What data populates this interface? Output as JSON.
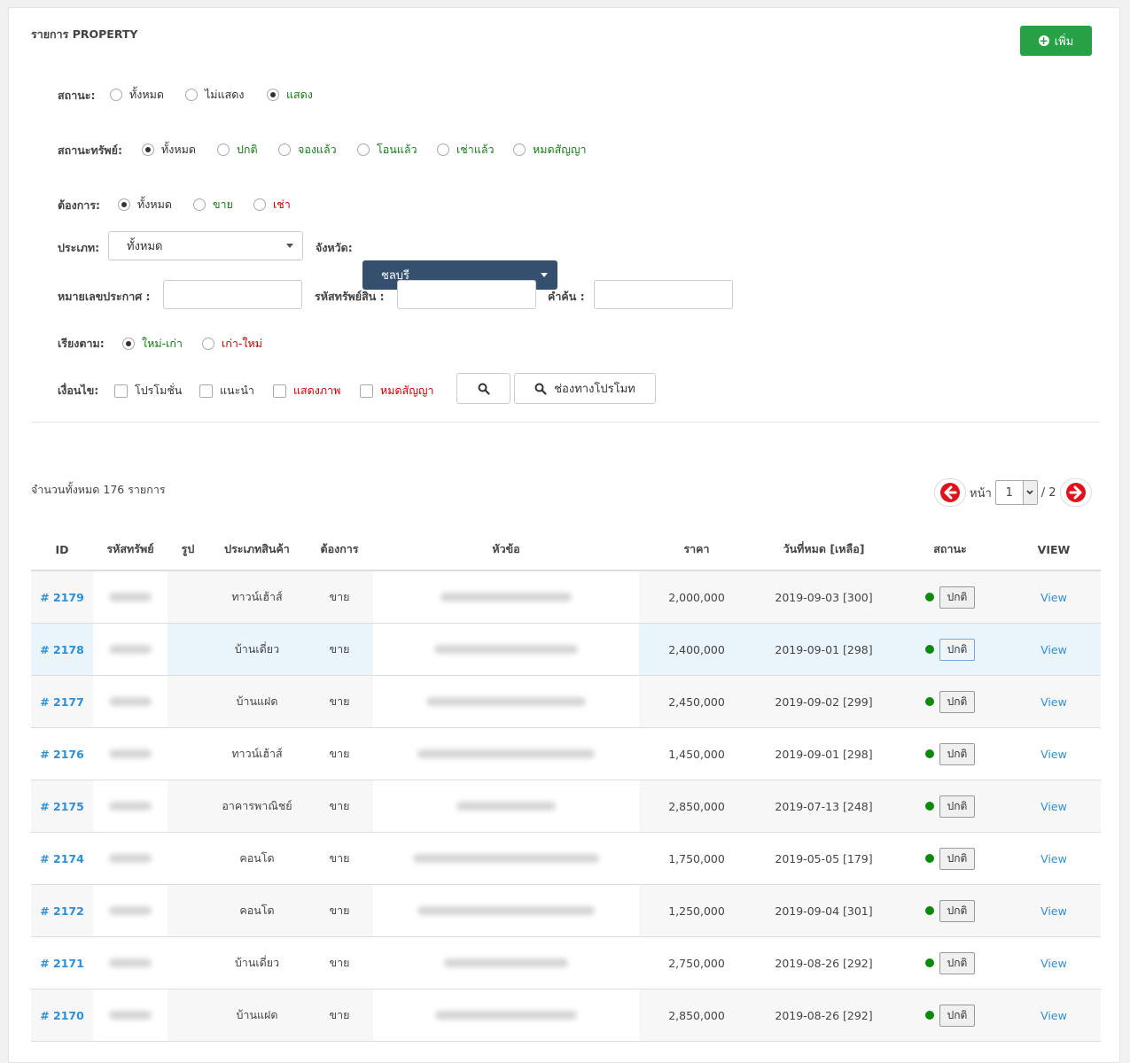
{
  "title": "รายการ PROPERTY",
  "add_button": "เพิ่ม",
  "filters": {
    "status": {
      "label": "สถานะ:",
      "options": [
        {
          "text": "ทั้งหมด",
          "color": "black",
          "checked": false
        },
        {
          "text": "ไม่แสดง",
          "color": "black",
          "checked": false
        },
        {
          "text": "แสดง",
          "color": "green",
          "checked": true
        }
      ]
    },
    "asset_status": {
      "label": "สถานะทรัพย์:",
      "options": [
        {
          "text": "ทั้งหมด",
          "color": "black",
          "checked": true
        },
        {
          "text": "ปกติ",
          "color": "green",
          "checked": false
        },
        {
          "text": "จองแล้ว",
          "color": "green",
          "checked": false
        },
        {
          "text": "โอนแล้ว",
          "color": "green",
          "checked": false
        },
        {
          "text": "เช่าแล้ว",
          "color": "green",
          "checked": false
        },
        {
          "text": "หมดสัญญา",
          "color": "green",
          "checked": false
        }
      ]
    },
    "want": {
      "label": "ต้องการ:",
      "options": [
        {
          "text": "ทั้งหมด",
          "color": "black",
          "checked": true
        },
        {
          "text": "ขาย",
          "color": "green",
          "checked": false
        },
        {
          "text": "เช่า",
          "color": "red",
          "checked": false
        }
      ]
    },
    "type": {
      "label": "ประเภท:",
      "value": "ทั้งหมด"
    },
    "province": {
      "label": "จังหวัด:",
      "value": "ชลบุรี"
    },
    "ad_number_label": "หมายเลขประกาศ :",
    "asset_code_label": "รหัสทรัพย์สิน :",
    "keyword_label": "คำค้น :",
    "sort": {
      "label": "เรียงตาม:",
      "options": [
        {
          "text": "ใหม่-เก่า",
          "color": "green",
          "checked": true
        },
        {
          "text": "เก่า-ใหม่",
          "color": "red",
          "checked": false
        }
      ]
    },
    "conditions": {
      "label": "เงื่อนไข:",
      "options": [
        {
          "text": "โปรโมชั่น",
          "color": "black"
        },
        {
          "text": "แนะนำ",
          "color": "black"
        },
        {
          "text": "แสดงภาพ",
          "color": "red"
        },
        {
          "text": "หมดสัญญา",
          "color": "red"
        }
      ]
    },
    "promo_button": "ช่องทางโปรโมท"
  },
  "total_text": "จำนวนทั้งหมด 176 รายการ",
  "pagination": {
    "page_label": "หน้า",
    "current": "1",
    "total": "/ 2"
  },
  "colors": {
    "green_btn": "#27a046",
    "dark_select": "#35506f",
    "link": "#2f8fd6",
    "status_dot": "#0b8a0b"
  },
  "table": {
    "headers": [
      "ID",
      "รหัสทรัพย์",
      "รูป",
      "ประเภทสินค้า",
      "ต้องการ",
      "หัวข้อ",
      "ราคา",
      "วันที่หมด [เหลือ]",
      "สถานะ",
      "VIEW"
    ],
    "rows": [
      {
        "id": "# 2179",
        "type": "ทาวน์เฮ้าส์",
        "want": "ขาย",
        "price": "2,000,000",
        "expire": "2019-09-03 [300]",
        "status": "ปกติ",
        "view": "View"
      },
      {
        "id": "# 2178",
        "type": "บ้านเดี่ยว",
        "want": "ขาย",
        "price": "2,400,000",
        "expire": "2019-09-01 [298]",
        "status": "ปกติ",
        "view": "View"
      },
      {
        "id": "# 2177",
        "type": "บ้านแฝด",
        "want": "ขาย",
        "price": "2,450,000",
        "expire": "2019-09-02 [299]",
        "status": "ปกติ",
        "view": "View"
      },
      {
        "id": "# 2176",
        "type": "ทาวน์เฮ้าส์",
        "want": "ขาย",
        "price": "1,450,000",
        "expire": "2019-09-01 [298]",
        "status": "ปกติ",
        "view": "View"
      },
      {
        "id": "# 2175",
        "type": "อาคารพาณิชย์",
        "want": "ขาย",
        "price": "2,850,000",
        "expire": "2019-07-13 [248]",
        "status": "ปกติ",
        "view": "View"
      },
      {
        "id": "# 2174",
        "type": "คอนโด",
        "want": "ขาย",
        "price": "1,750,000",
        "expire": "2019-05-05 [179]",
        "status": "ปกติ",
        "view": "View"
      },
      {
        "id": "# 2172",
        "type": "คอนโด",
        "want": "ขาย",
        "price": "1,250,000",
        "expire": "2019-09-04 [301]",
        "status": "ปกติ",
        "view": "View"
      },
      {
        "id": "# 2171",
        "type": "บ้านเดี่ยว",
        "want": "ขาย",
        "price": "2,750,000",
        "expire": "2019-08-26 [292]",
        "status": "ปกติ",
        "view": "View"
      },
      {
        "id": "# 2170",
        "type": "บ้านแฝด",
        "want": "ขาย",
        "price": "2,850,000",
        "expire": "2019-08-26 [292]",
        "status": "ปกติ",
        "view": "View"
      }
    ]
  }
}
